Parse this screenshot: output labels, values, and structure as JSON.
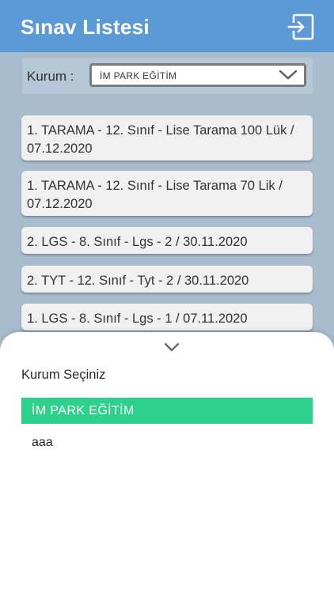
{
  "header": {
    "title": "Sınav Listesi",
    "icon": "logout-icon"
  },
  "filter": {
    "label": "Kurum :",
    "selected_value": "İM PARK EĞİTİM"
  },
  "exams": [
    {
      "line1": "1. TARAMA - 12. Sınıf - Lise Tarama 100 Lük /",
      "line2": "07.12.2020"
    },
    {
      "line1": "1. TARAMA - 12. Sınıf - Lise Tarama 70 Lik /",
      "line2": "07.12.2020"
    },
    {
      "line1": "2. LGS - 8. Sınıf - Lgs - 2 / 30.11.2020"
    },
    {
      "line1": "2. TYT  - 12. Sınıf - Tyt - 2 / 30.11.2020"
    },
    {
      "line1": "1. LGS - 8. Sınıf - Lgs - 1 / 07.11.2020"
    }
  ],
  "sheet": {
    "title": "Kurum Seçiniz",
    "options": [
      {
        "label": "İM PARK EĞİTİM",
        "selected": true
      },
      {
        "label": "aaa",
        "selected": false
      }
    ]
  },
  "colors": {
    "header": "#5b9ad7",
    "background": "#a9bccd",
    "selected_option": "#2ed18b"
  }
}
